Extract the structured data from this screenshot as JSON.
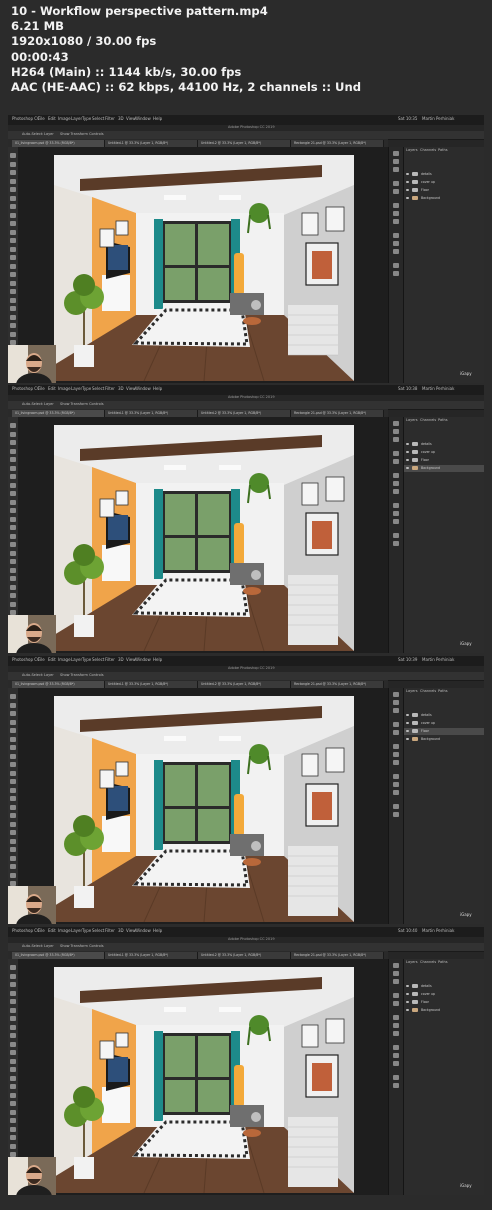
{
  "header": {
    "filename": "10 - Workflow perspective pattern.mp4",
    "filesize": "6.21 MB",
    "resolution": "1920x1080 / 30.00 fps",
    "duration": "00:00:43",
    "video": "H264 (Main) :: 1144 kb/s, 30.00 fps",
    "audio": "AAC (HE-AAC) :: 62 kbps, 44100 Hz, 2 channels :: Und"
  },
  "app": {
    "menu_items": [
      "Photoshop CC",
      "File",
      "Edit",
      "Image",
      "Layer",
      "Type",
      "Select",
      "Filter",
      "3D",
      "View",
      "Window",
      "Help"
    ],
    "menu_right": "Martin Perhiniak",
    "window_title": "Adobe Photoshop CC 2019",
    "options": [
      "Auto-Select:",
      "Layer",
      "Show Transform Controls"
    ],
    "tabs": [
      "01_livingroom.psd @ 33.3% (RGB/8*)",
      "Untitled-1 @ 33.3% (Layer 1, RGB/8*)",
      "Untitled-2 @ 33.3% (Layer 1, RGB/8*)",
      "Rectangle 21.psd @ 33.3% (Layer 1, RGB/8*)"
    ],
    "panel_tabs": [
      "Layers",
      "Channels",
      "Paths"
    ],
    "layers": [
      {
        "name": "details",
        "type": "folder"
      },
      {
        "name": "cover up",
        "type": "folder"
      },
      {
        "name": "Floor",
        "type": "folder"
      },
      {
        "name": "Background",
        "type": "image"
      }
    ],
    "watermark": "iGapy"
  },
  "frames": [
    {
      "time": "Sat 10:35",
      "selected_layer": -1
    },
    {
      "time": "Sat 10:38",
      "selected_layer": 3
    },
    {
      "time": "Sat 10:39",
      "selected_layer": 2
    },
    {
      "time": "Sat 10:40",
      "selected_layer": -1
    }
  ]
}
